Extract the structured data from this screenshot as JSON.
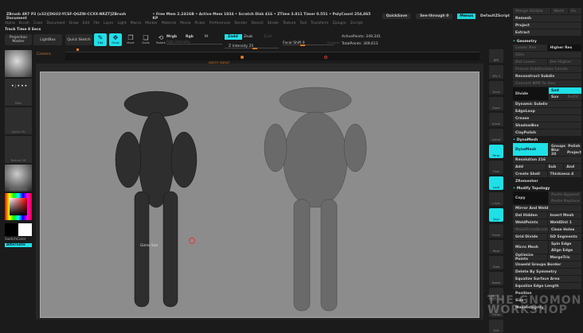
{
  "titlebar": {
    "title": "ZBrush 4R7 P3 (x32)[DGU2-YCSF-QGZW-CCXX-NRZT]ZBrush Document",
    "stats": "• Free Mem 2.241GB • Active Mem 1834 • Scratch Disk 416 • ZTime 3.811 Timer 0.551 • PolyCount 254,865 KP",
    "quicksave": "QuickSave",
    "seethrough": "See-through 0",
    "menus_btn": "Menus",
    "script": "DefaultZScript"
  },
  "menubar": [
    "Alpha",
    "Brush",
    "Color",
    "Document",
    "Draw",
    "Edit",
    "File",
    "Layer",
    "Light",
    "Macro",
    "Marker",
    "Material",
    "Movie",
    "Picker",
    "Preferences",
    "Render",
    "Stencil",
    "Stroke",
    "Texture",
    "Tool",
    "Transform",
    "Zplugin",
    "Zscript"
  ],
  "track": "Track Time 8 Secs",
  "toolbar": {
    "projection_master": "Projection Master",
    "lightbox": "LightBox",
    "quick_sketch": "Quick Sketch",
    "edit": "Edit",
    "draw": "Draw",
    "move": "Move",
    "scale": "Scale",
    "rotate": "Rotate",
    "mrgb": "Mrgb",
    "rgb": "Rgb",
    "m": "M",
    "rgb_intensity": "Rgb Intensity",
    "zadd": "Zadd",
    "zsub": "Zsub",
    "zcut": "Zcut",
    "z_intensity": "Z Intensity 25",
    "focal_shift": "Focal Shift 0",
    "draw_size": "Draw Size 11",
    "dynamic": "Dynamic",
    "active_points": "ActivePoints: 249,341",
    "total_points": "TotalPoints: 309,613"
  },
  "timeline": {
    "label": "Camera",
    "time": "00022 00041"
  },
  "leftpanel": {
    "brush": "Standard",
    "stroke": "Dots",
    "alpha": "Alpha Off",
    "texture": "Texture Off",
    "material": "MatCap Gray",
    "switch_color": "SwitchColor",
    "alternate": "Alternate"
  },
  "canvas": {
    "cursor_label": "Gizmo Size"
  },
  "shelf": [
    "BPR",
    "SPix 3",
    "Scroll",
    "Zoom",
    "Actual",
    "AAHalf",
    "Persp",
    "Floor",
    "Local",
    "L.Sym",
    "Qxyz",
    "Frame",
    "Move",
    "Scale",
    "Rotate",
    "Line Fill PolyF",
    "Transp",
    "Solo"
  ],
  "rpanel": {
    "top": [
      "Merge Visible",
      "Weld",
      "Uv",
      "Remesh",
      "Project",
      "Extract"
    ],
    "geometry_title": "Geometry",
    "geometry": {
      "lower_res": "Lower Res",
      "higher_res": "Higher Res",
      "sdiv": "SDiv",
      "del_lower": "Del Lower",
      "del_higher": "Del Higher",
      "freeze": "Freeze SubDivision Levels",
      "reconstruct": "Reconstruct Subdiv",
      "convert": "Convert BPR To Geo",
      "divide": "Divide",
      "smt": "Smt",
      "suv": "Suv",
      "rsmt": "ReUV",
      "dynamic_subdiv": "Dynamic Subdiv",
      "edgeloop": "EdgeLoop",
      "crease": "Crease",
      "shadowbox": "ShadowBox",
      "claypolish": "ClayPolish"
    },
    "dynamesh_title": "DynaMesh",
    "dynamesh": {
      "dynamesh": "DynaMesh",
      "groups": "Groups",
      "polish": "Polish",
      "blur": "Blur 20",
      "project": "Project",
      "resolution": "Resolution 216",
      "add": "Add",
      "sub": "Sub",
      "and": "And",
      "create_shell": "Create Shell",
      "thickness": "Thickness 4"
    },
    "zremesher": "ZRemesher",
    "modify_title": "Modify Topology",
    "modify": {
      "copy": "Copy",
      "paste_append": "Paste Append",
      "paste_replace": "Paste Replace",
      "mirror_weld": "Mirror And Weld",
      "del_hidden": "Del Hidden",
      "insert_mesh": "Insert Mesh",
      "weldpoints": "WeldPoints",
      "welddist": "WeldDist 1",
      "meshfromb": "MeshFromBrush",
      "close_holes": "Close Holes",
      "grid_divide": "Grid Divide",
      "gd_segments": "GD Segments",
      "micro_mesh": "Micro Mesh",
      "spin_edge": "Spin Edge",
      "align_edge": "Align Edge",
      "optimize": "Optimize Points",
      "mergetris": "MergeTris",
      "unweld": "Unweld Groups Border",
      "delete_sym": "Delete By Symmetry",
      "equalize_area": "Equalize Surface Area",
      "equalize_edge": "Equalize Edge Length",
      "position": "Position",
      "size": "Size",
      "meshintegrity": "MeshIntegrity"
    }
  },
  "watermark": "THE GNOMON WORKSHOP",
  "colors": {
    "accent": "#1fe0e6",
    "orange": "#e07a1f",
    "canvas": "#8c8c8c"
  }
}
